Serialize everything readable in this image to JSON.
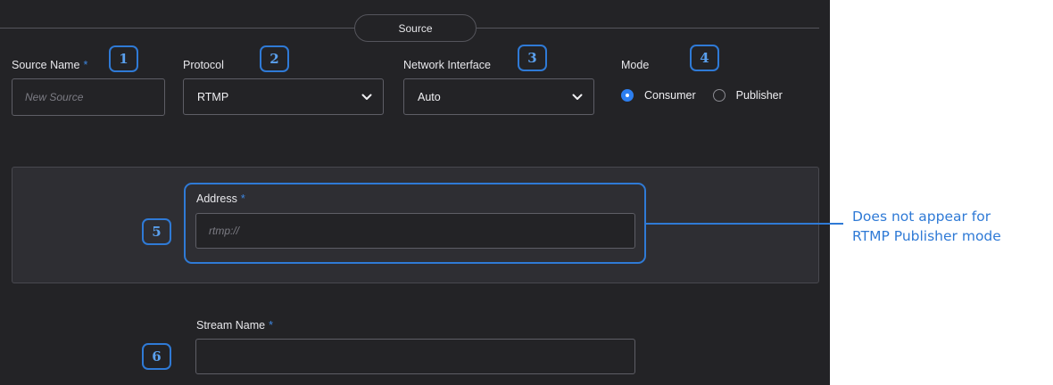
{
  "section": {
    "title": "Source"
  },
  "fields": {
    "source_name": {
      "label": "Source Name",
      "required_mark": "*",
      "placeholder": "New Source",
      "value": ""
    },
    "protocol": {
      "label": "Protocol",
      "value": "RTMP"
    },
    "network_interface": {
      "label": "Network Interface",
      "value": "Auto"
    },
    "mode": {
      "label": "Mode",
      "options": [
        {
          "label": "Consumer",
          "selected": true
        },
        {
          "label": "Publisher",
          "selected": false
        }
      ]
    },
    "address": {
      "label": "Address",
      "required_mark": "*",
      "placeholder": "rtmp://",
      "value": ""
    },
    "stream_name": {
      "label": "Stream Name",
      "required_mark": "*",
      "placeholder": "",
      "value": ""
    }
  },
  "callouts": [
    "1",
    "2",
    "3",
    "4",
    "5",
    "6"
  ],
  "annotation": {
    "line1": "Does not appear for",
    "line2": "RTMP Publisher mode"
  },
  "colors": {
    "panel_background": "#232326",
    "accent_blue": "#2f7ad6",
    "radio_selected": "#2d7ff0",
    "text": "#e8e8ec"
  },
  "icons": {
    "dropdown": "chevron-down-icon",
    "radio": "radio-icon"
  }
}
